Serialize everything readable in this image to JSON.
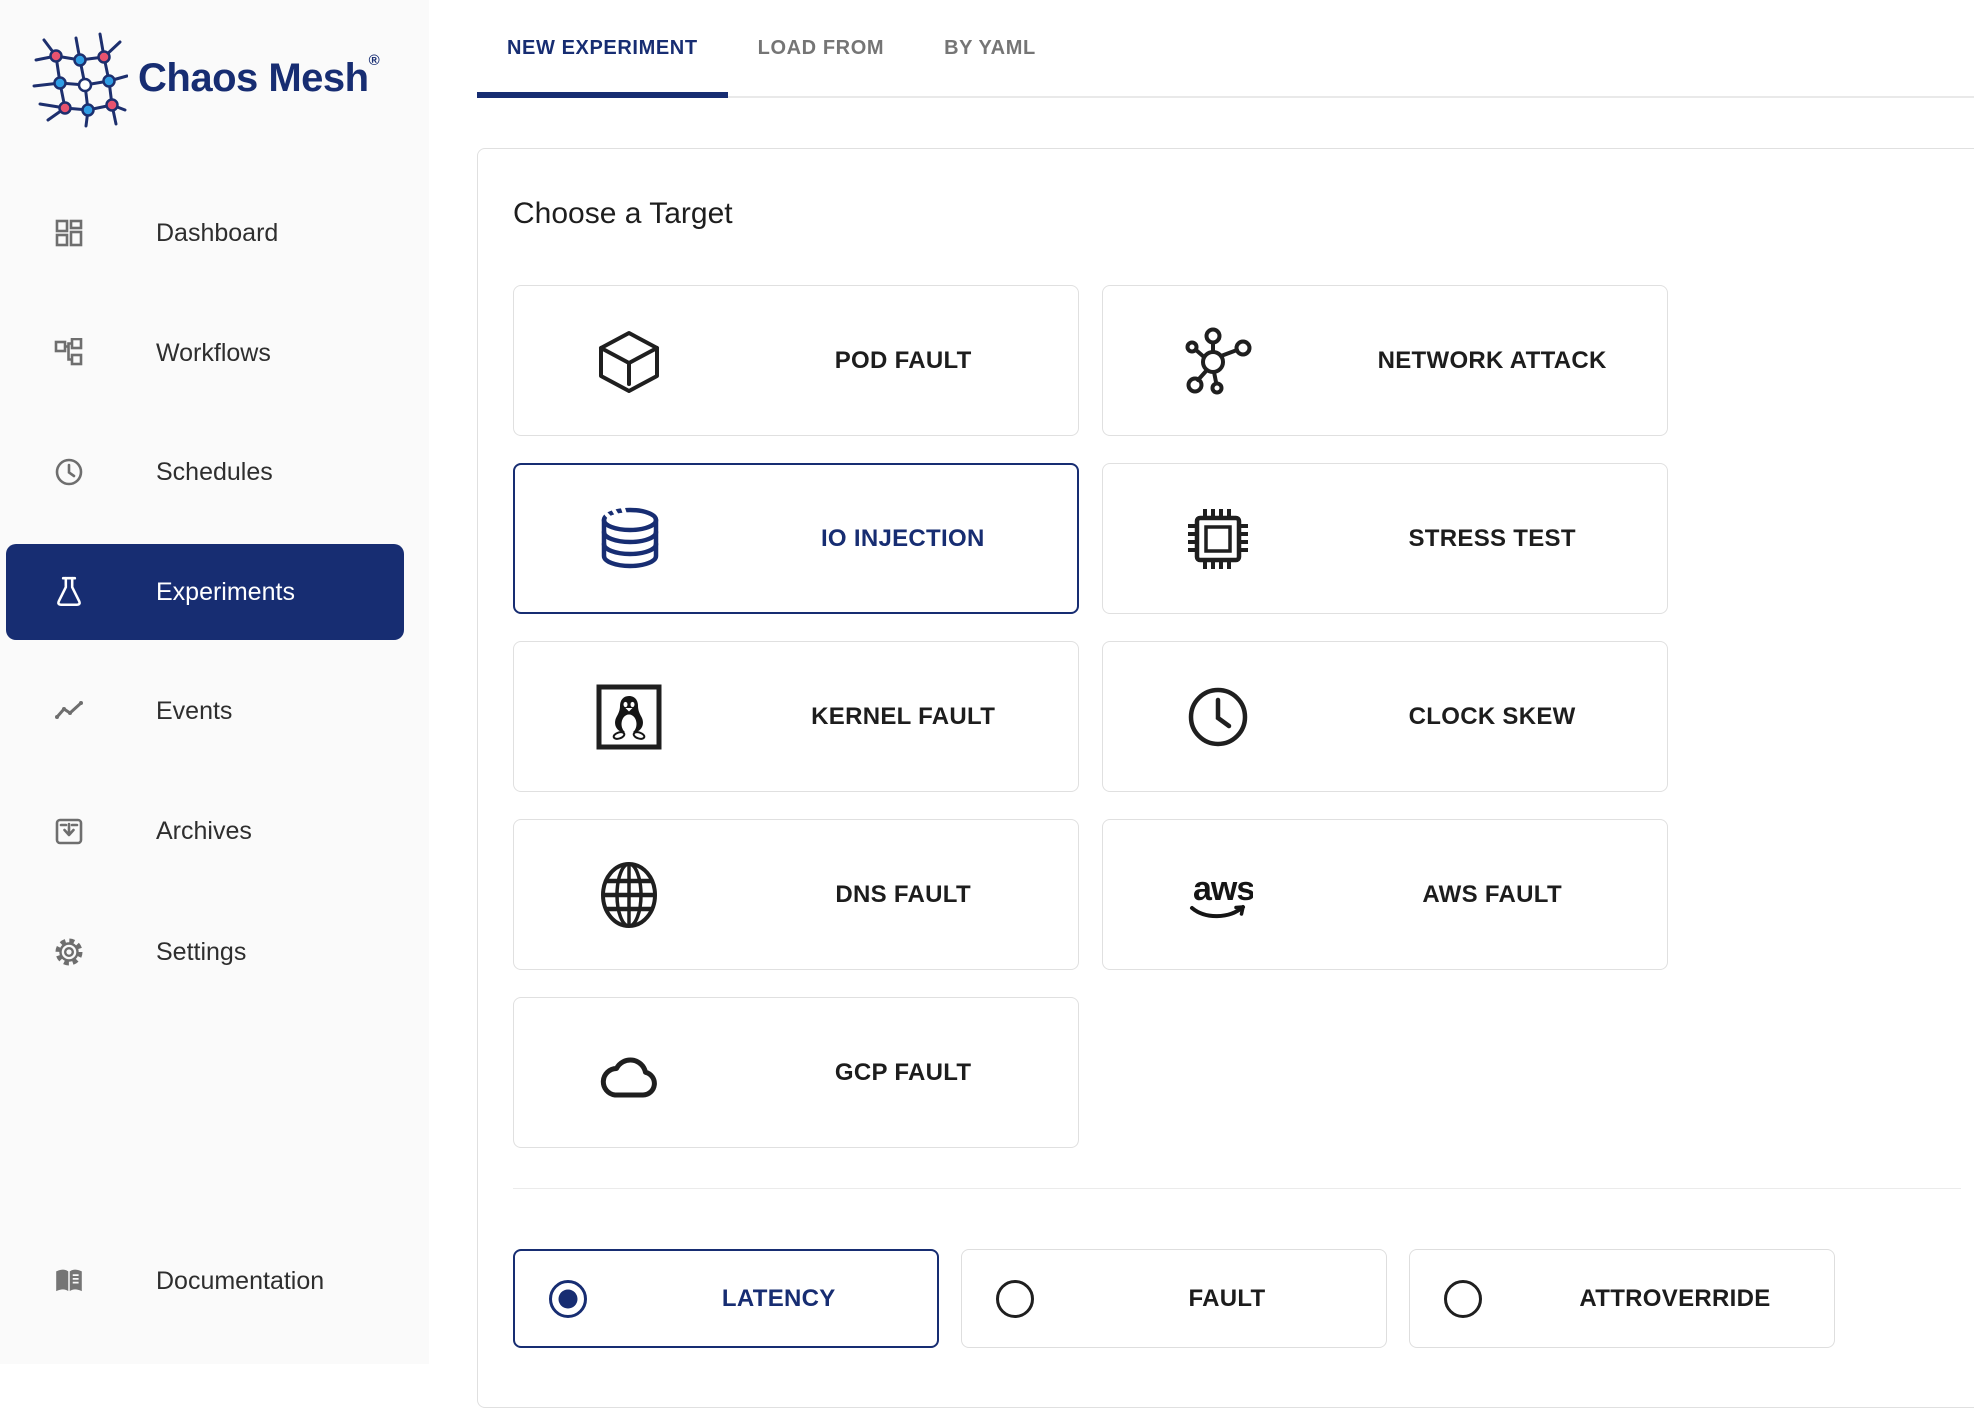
{
  "brand": {
    "name": "Chaos Mesh",
    "registered": "®"
  },
  "sidebar": {
    "items": [
      {
        "label": "Dashboard",
        "active": false
      },
      {
        "label": "Workflows",
        "active": false
      },
      {
        "label": "Schedules",
        "active": false
      },
      {
        "label": "Experiments",
        "active": true
      },
      {
        "label": "Events",
        "active": false
      },
      {
        "label": "Archives",
        "active": false
      },
      {
        "label": "Settings",
        "active": false
      }
    ],
    "footer_item": {
      "label": "Documentation"
    }
  },
  "tabs": [
    {
      "label": "NEW EXPERIMENT",
      "active": true
    },
    {
      "label": "LOAD FROM",
      "active": false
    },
    {
      "label": "BY YAML",
      "active": false
    }
  ],
  "panel": {
    "title": "Choose a Target",
    "targets": [
      {
        "label": "POD FAULT",
        "icon": "pod-cube-icon",
        "selected": false
      },
      {
        "label": "NETWORK ATTACK",
        "icon": "network-icon",
        "selected": false
      },
      {
        "label": "IO INJECTION",
        "icon": "database-icon",
        "selected": true
      },
      {
        "label": "STRESS TEST",
        "icon": "cpu-chip-icon",
        "selected": false
      },
      {
        "label": "KERNEL FAULT",
        "icon": "linux-tux-icon",
        "selected": false
      },
      {
        "label": "CLOCK SKEW",
        "icon": "clock-icon",
        "selected": false
      },
      {
        "label": "DNS FAULT",
        "icon": "globe-icon",
        "selected": false
      },
      {
        "label": "AWS FAULT",
        "icon": "aws-logo-icon",
        "icon_text": "aws",
        "selected": false
      },
      {
        "label": "GCP FAULT",
        "icon": "cloud-icon",
        "selected": false
      }
    ],
    "actions": [
      {
        "label": "LATENCY",
        "selected": true
      },
      {
        "label": "FAULT",
        "selected": false
      },
      {
        "label": "ATTROVERRIDE",
        "selected": false
      }
    ]
  },
  "colors": {
    "primary": "#172d72",
    "card_border": "#e0e0e0",
    "icon_gray": "#6e6e6e",
    "logo_node_blue": "#2f9de4",
    "logo_node_red": "#e8536f"
  }
}
